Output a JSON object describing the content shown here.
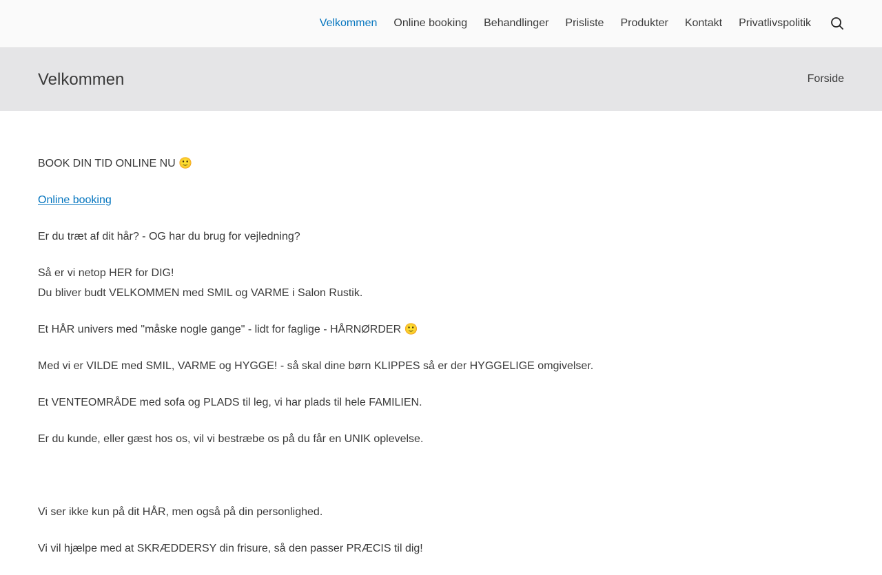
{
  "nav": {
    "items": [
      {
        "label": "Velkommen",
        "active": true
      },
      {
        "label": "Online booking"
      },
      {
        "label": "Behandlinger"
      },
      {
        "label": "Prisliste"
      },
      {
        "label": "Produkter"
      },
      {
        "label": "Kontakt"
      },
      {
        "label": "Privatlivspolitik"
      }
    ],
    "search_icon": "search-icon"
  },
  "title_bar": {
    "title": "Velkommen",
    "breadcrumb": "Forside"
  },
  "content": {
    "book_line": "BOOK DIN TID ONLINE NU 🙂",
    "booking_link": "Online booking",
    "p1": "Er du træt af dit hår? - OG har du brug for vejledning?",
    "p2_line1": "Så er vi netop HER for DIG!",
    "p2_line2": "Du bliver budt VELKOMMEN med SMIL og VARME i Salon Rustik.",
    "p3": "Et HÅR univers med \"måske nogle gange\" - lidt for faglige - HÅRNØRDER 🙂",
    "p4": "Med vi er VILDE med SMIL, VARME og HYGGE! - så skal dine børn KLIPPES så er der HYGGELIGE omgivelser.",
    "p5": "Et VENTEOMRÅDE med sofa og PLADS til leg, vi har plads til hele FAMILIEN.",
    "p6": "Er du kunde, eller gæst hos os, vil vi bestræbe os på du får en UNIK oplevelse.",
    "p7": "Vi ser ikke kun på dit HÅR, men også på din personlighed.",
    "p8": "Vi vil hjælpe med at SKRÆDDERSY din frisure, så den passer PRÆCIS til dig!"
  },
  "colors": {
    "accent": "#0274be",
    "text": "#3a3a3a",
    "title_bar_bg": "#e5e5e7",
    "header_bg": "#fafafa"
  }
}
